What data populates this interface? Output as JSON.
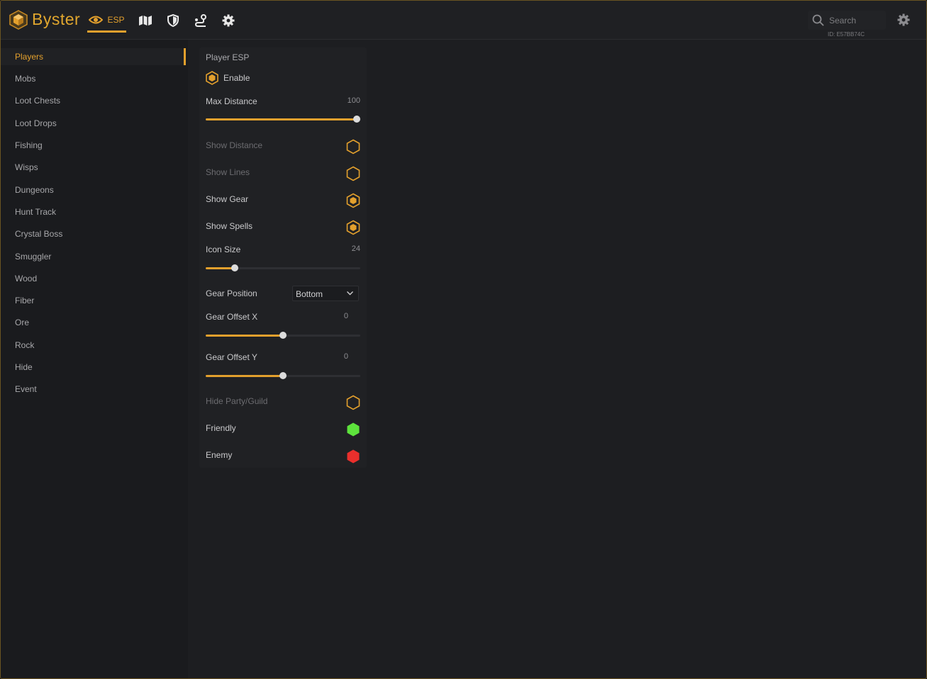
{
  "app": {
    "name": "Byster",
    "client_id": "ID: E57BB74C"
  },
  "nav_tabs": [
    {
      "icon": "eye-icon",
      "label": "ESP",
      "active": true
    },
    {
      "icon": "map-icon",
      "label": ""
    },
    {
      "icon": "shield-icon",
      "label": ""
    },
    {
      "icon": "route-icon",
      "label": ""
    },
    {
      "icon": "gear-icon",
      "label": ""
    }
  ],
  "search": {
    "placeholder": "Search",
    "value": ""
  },
  "sidebar": {
    "items": [
      {
        "label": "Players",
        "active": true
      },
      {
        "label": "Mobs"
      },
      {
        "label": "Loot Chests"
      },
      {
        "label": "Loot Drops"
      },
      {
        "label": "Fishing"
      },
      {
        "label": "Wisps"
      },
      {
        "label": "Dungeons"
      },
      {
        "label": "Hunt Track"
      },
      {
        "label": "Crystal Boss"
      },
      {
        "label": "Smuggler"
      },
      {
        "label": "Wood"
      },
      {
        "label": "Fiber"
      },
      {
        "label": "Ore"
      },
      {
        "label": "Rock"
      },
      {
        "label": "Hide"
      },
      {
        "label": "Event"
      }
    ]
  },
  "panel": {
    "title": "Player ESP",
    "enable": {
      "label": "Enable",
      "checked": true
    },
    "max_distance": {
      "label": "Max Distance",
      "value": "100",
      "fraction": 1.0
    },
    "show_distance": {
      "label": "Show Distance",
      "checked": false
    },
    "show_lines": {
      "label": "Show Lines",
      "checked": false
    },
    "show_gear": {
      "label": "Show Gear",
      "checked": true
    },
    "show_spells": {
      "label": "Show Spells",
      "checked": true
    },
    "icon_size": {
      "label": "Icon Size",
      "value": "24",
      "fraction": 0.19
    },
    "gear_position": {
      "label": "Gear Position",
      "value": "Bottom"
    },
    "gear_offset_x": {
      "label": "Gear Offset X",
      "value": "0",
      "fraction": 0.5
    },
    "gear_offset_y": {
      "label": "Gear Offset Y",
      "value": "0",
      "fraction": 0.5
    },
    "hide_party_guild": {
      "label": "Hide Party/Guild",
      "checked": false
    },
    "friendly": {
      "label": "Friendly",
      "color": "#5de33c"
    },
    "enemy": {
      "label": "Enemy",
      "color": "#ea2f2c"
    }
  },
  "colors": {
    "accent": "#e3a02d",
    "background": "#1d1e21"
  }
}
